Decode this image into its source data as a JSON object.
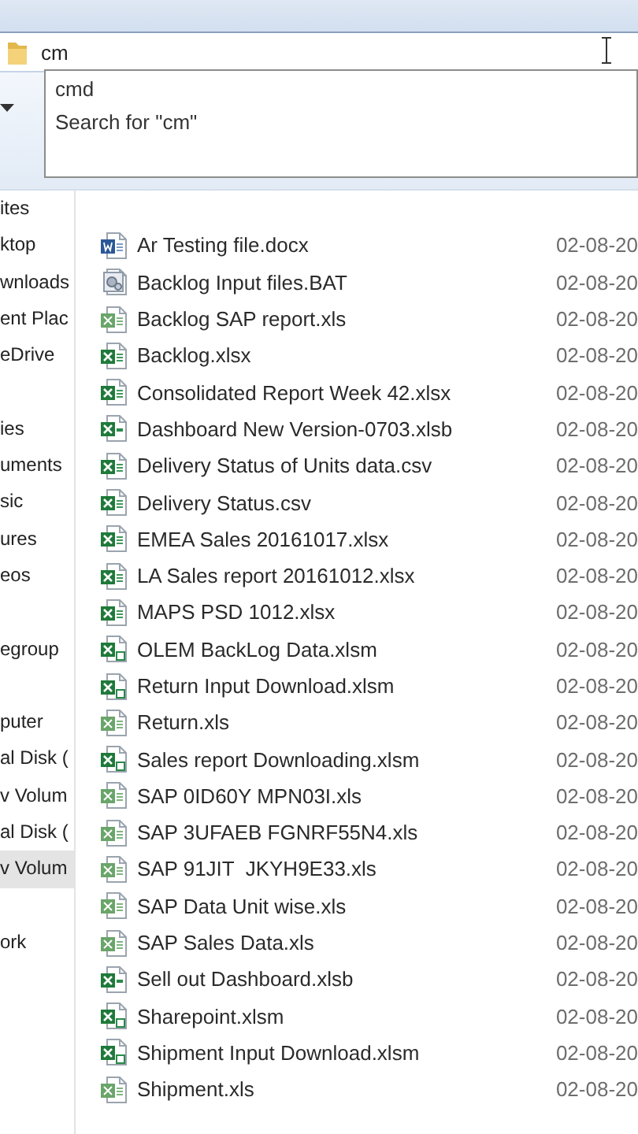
{
  "address_bar": {
    "value": "cm"
  },
  "suggestions": [
    {
      "label": "cmd"
    },
    {
      "label": "Search for \"cm\""
    }
  ],
  "sidebar": {
    "groups": [
      [
        {
          "label": "ites",
          "selected": false
        },
        {
          "label": "ktop",
          "selected": false
        },
        {
          "label": "wnloads",
          "selected": false
        },
        {
          "label": "ent Plac",
          "selected": false
        },
        {
          "label": "eDrive",
          "selected": false
        }
      ],
      [
        {
          "label": "ies",
          "selected": false
        },
        {
          "label": "uments",
          "selected": false
        },
        {
          "label": "sic",
          "selected": false
        },
        {
          "label": "ures",
          "selected": false
        },
        {
          "label": "eos",
          "selected": false
        }
      ],
      [
        {
          "label": "egroup",
          "selected": false
        }
      ],
      [
        {
          "label": "puter",
          "selected": false
        },
        {
          "label": "al Disk (",
          "selected": false
        },
        {
          "label": "v Volum",
          "selected": false
        },
        {
          "label": "al Disk (",
          "selected": false
        },
        {
          "label": "v Volum",
          "selected": true
        }
      ],
      [
        {
          "label": "ork",
          "selected": false
        }
      ]
    ]
  },
  "files": [
    {
      "name": "Ar Testing file.docx",
      "kind": "word",
      "date": "02-08-20"
    },
    {
      "name": "Backlog Input files.BAT",
      "kind": "bat",
      "date": "02-08-20"
    },
    {
      "name": "Backlog SAP report.xls",
      "kind": "xls",
      "date": "02-08-20"
    },
    {
      "name": "Backlog.xlsx",
      "kind": "xlsx",
      "date": "02-08-20"
    },
    {
      "name": "Consolidated Report Week 42.xlsx",
      "kind": "xlsx",
      "date": "02-08-20"
    },
    {
      "name": "Dashboard New Version-0703.xlsb",
      "kind": "xlsb",
      "date": "02-08-20"
    },
    {
      "name": "Delivery Status of Units data.csv",
      "kind": "xlsx",
      "date": "02-08-20"
    },
    {
      "name": "Delivery Status.csv",
      "kind": "xlsx",
      "date": "02-08-20"
    },
    {
      "name": "EMEA Sales 20161017.xlsx",
      "kind": "xlsx",
      "date": "02-08-20"
    },
    {
      "name": "LA Sales report 20161012.xlsx",
      "kind": "xlsx",
      "date": "02-08-20"
    },
    {
      "name": "MAPS PSD 1012.xlsx",
      "kind": "xlsx",
      "date": "02-08-20"
    },
    {
      "name": "OLEM BackLog Data.xlsm",
      "kind": "xlsm",
      "date": "02-08-20"
    },
    {
      "name": "Return Input Download.xlsm",
      "kind": "xlsm",
      "date": "02-08-20"
    },
    {
      "name": "Return.xls",
      "kind": "xls",
      "date": "02-08-20"
    },
    {
      "name": "Sales report Downloading.xlsm",
      "kind": "xlsm",
      "date": "02-08-20"
    },
    {
      "name": "SAP 0ID60Y MPN03I.xls",
      "kind": "xls",
      "date": "02-08-20"
    },
    {
      "name": "SAP 3UFAEB FGNRF55N4.xls",
      "kind": "xls",
      "date": "02-08-20"
    },
    {
      "name": "SAP 91JIT  JKYH9E33.xls",
      "kind": "xls",
      "date": "02-08-20"
    },
    {
      "name": "SAP Data Unit wise.xls",
      "kind": "xls",
      "date": "02-08-20"
    },
    {
      "name": "SAP Sales Data.xls",
      "kind": "xls",
      "date": "02-08-20"
    },
    {
      "name": "Sell out Dashboard.xlsb",
      "kind": "xlsb",
      "date": "02-08-20"
    },
    {
      "name": "Sharepoint.xlsm",
      "kind": "xlsm",
      "date": "02-08-20"
    },
    {
      "name": "Shipment Input Download.xlsm",
      "kind": "xlsm",
      "date": "02-08-20"
    },
    {
      "name": "Shipment.xls",
      "kind": "xls",
      "date": "02-08-20"
    }
  ]
}
